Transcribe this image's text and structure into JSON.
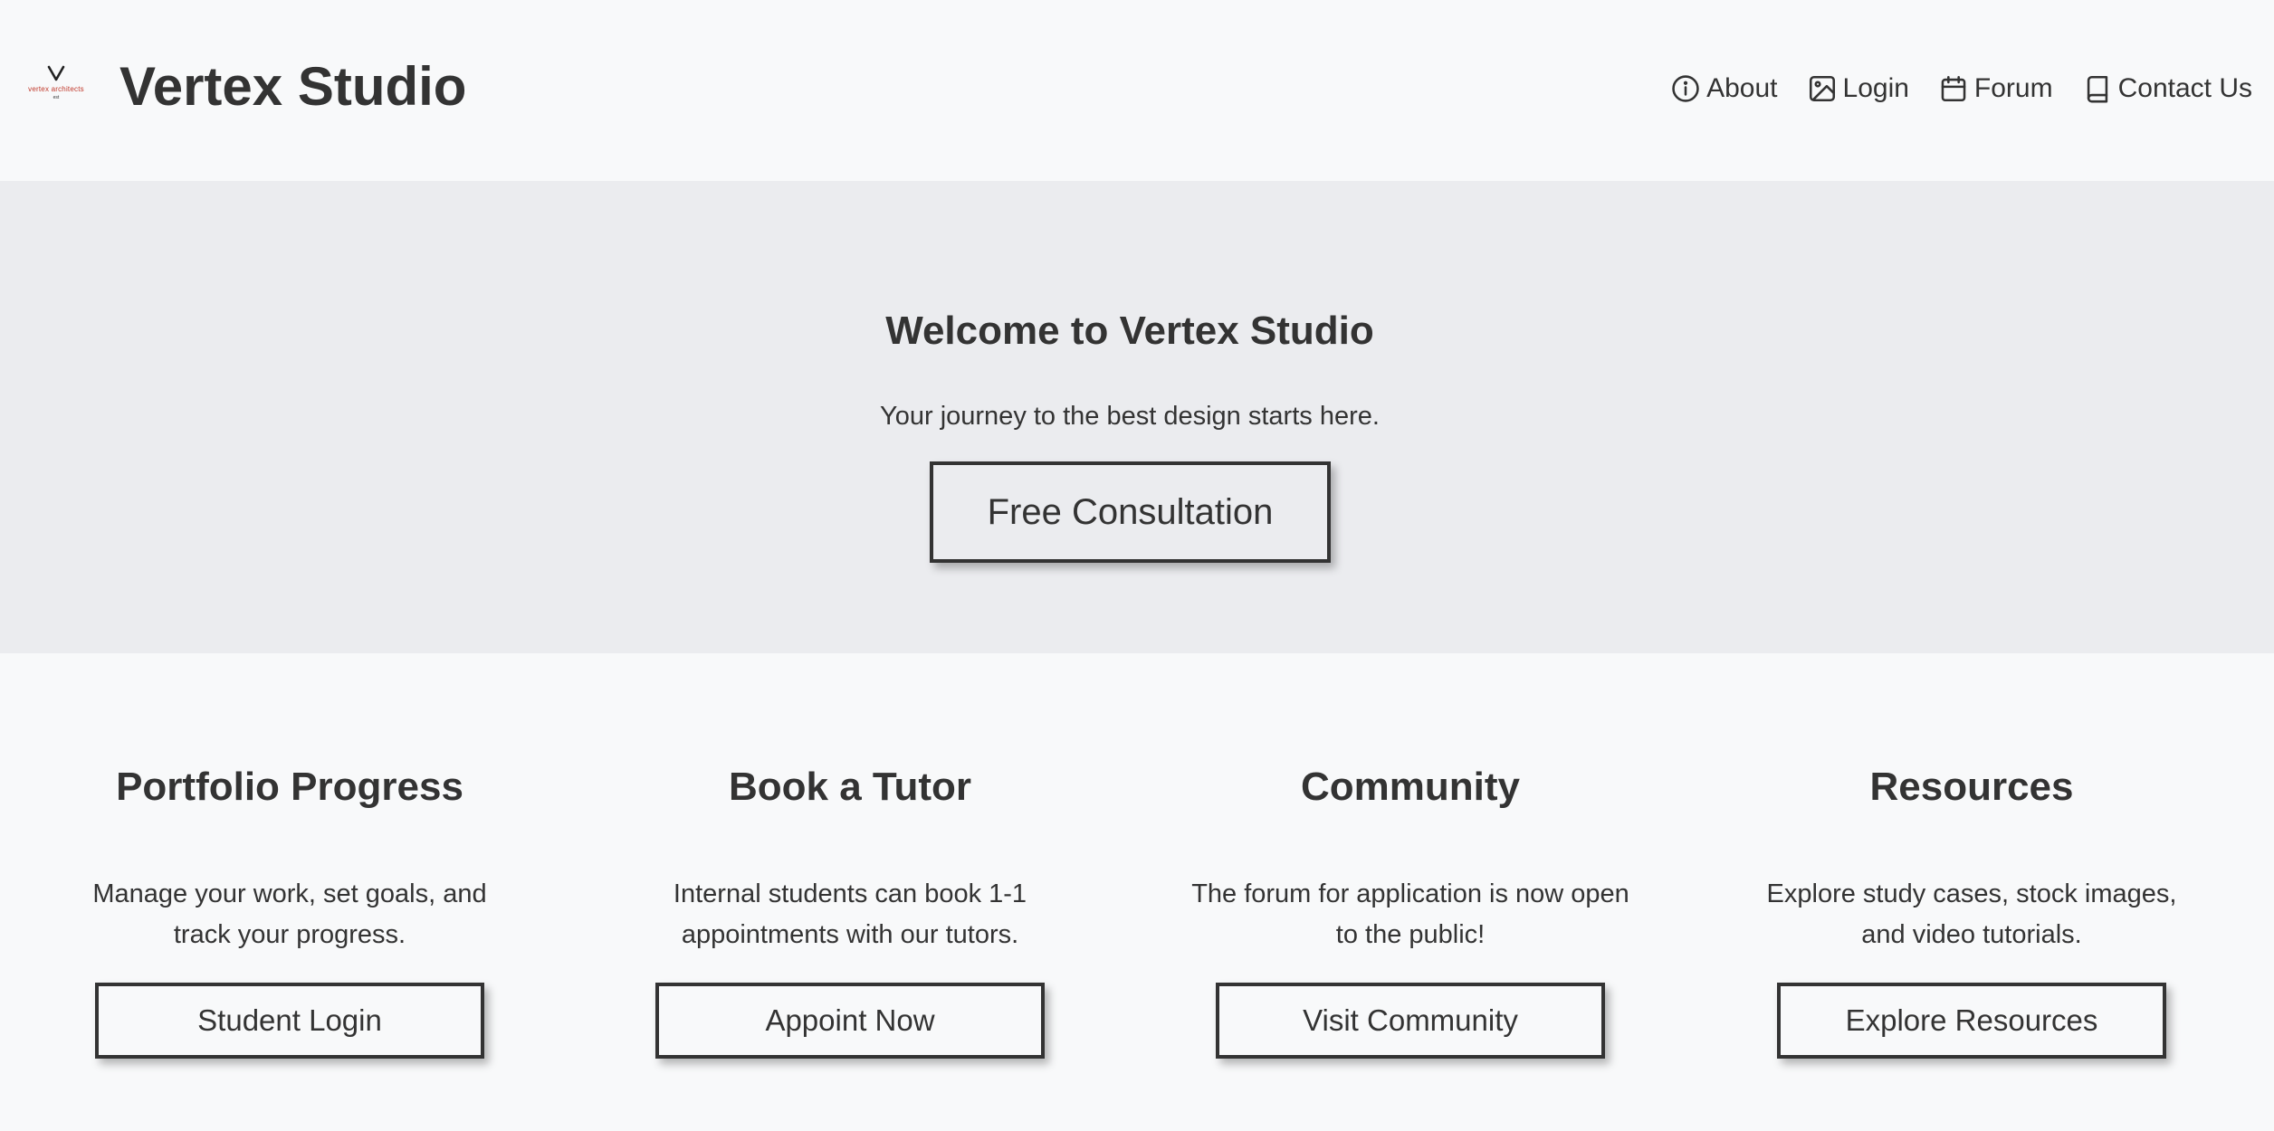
{
  "header": {
    "logo": {
      "text": "vertex architects",
      "subtext": "est"
    },
    "title": "Vertex Studio",
    "nav": [
      {
        "label": "About",
        "icon": "info-icon"
      },
      {
        "label": "Login",
        "icon": "image-icon"
      },
      {
        "label": "Forum",
        "icon": "calendar-icon"
      },
      {
        "label": "Contact Us",
        "icon": "book-icon"
      }
    ]
  },
  "hero": {
    "title": "Welcome to Vertex Studio",
    "subtitle": "Your journey to the best design starts here.",
    "button_label": "Free Consultation"
  },
  "features": [
    {
      "title": "Portfolio Progress",
      "description": "Manage your work, set goals, and track your progress.",
      "button_label": "Student Login"
    },
    {
      "title": "Book a Tutor",
      "description": "Internal students can book 1-1 appointments with our tutors.",
      "button_label": "Appoint Now"
    },
    {
      "title": "Community",
      "description": "The forum for application is now open to the public!",
      "button_label": "Visit Community"
    },
    {
      "title": "Resources",
      "description": "Explore study cases, stock images, and video tutorials.",
      "button_label": "Explore Resources"
    }
  ],
  "colors": {
    "text": "#333333",
    "page_background": "#f8f9fa",
    "hero_background": "#ebecef",
    "logo_accent": "#c0392b"
  }
}
